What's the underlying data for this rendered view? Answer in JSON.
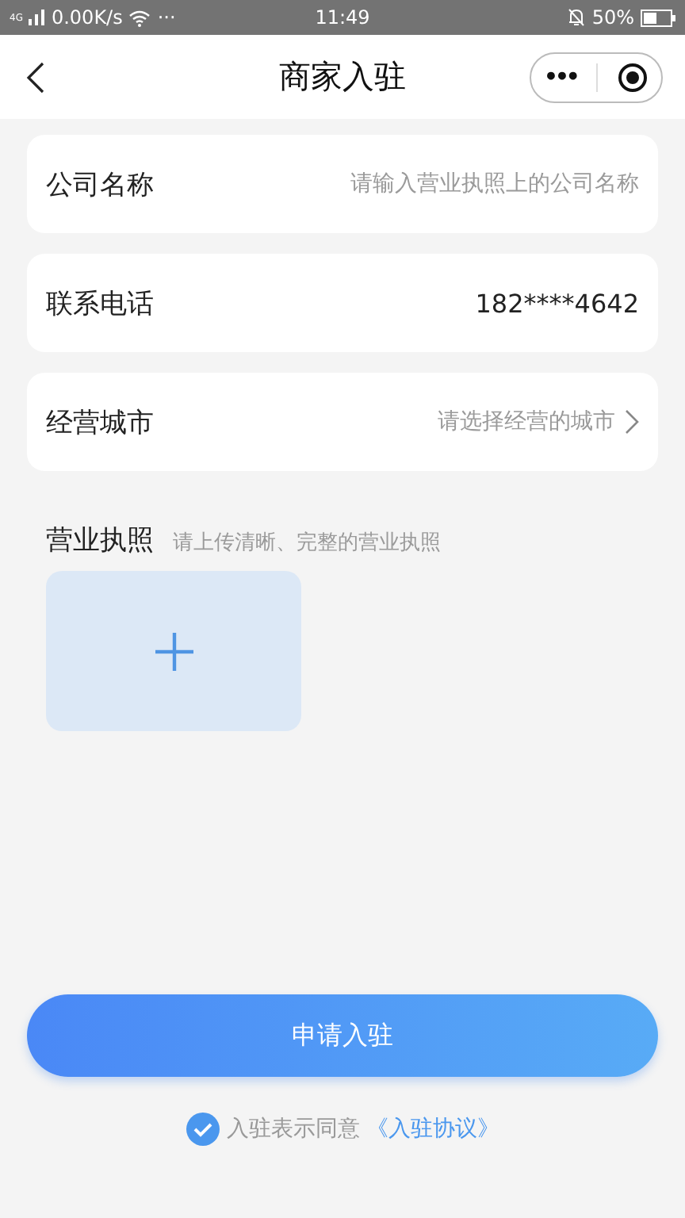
{
  "status_bar": {
    "network": "4G",
    "speed": "0.00K/s",
    "more": "···",
    "time": "11:49",
    "battery": "50%"
  },
  "nav": {
    "title": "商家入驻",
    "menu": "•••"
  },
  "fields": [
    {
      "kind": "input",
      "label": "公司名称",
      "placeholder": "请输入营业执照上的公司名称"
    },
    {
      "kind": "input",
      "label": "联系电话",
      "value": "182****4642"
    },
    {
      "kind": "picker",
      "label": "经营城市",
      "placeholder": "请选择经营的城市"
    }
  ],
  "license": {
    "label": "营业执照",
    "hint": "请上传清晰、完整的营业执照"
  },
  "submit": "申请入驻",
  "agreement": {
    "checked": true,
    "text": "入驻表示同意",
    "link": "《入驻协议》"
  }
}
